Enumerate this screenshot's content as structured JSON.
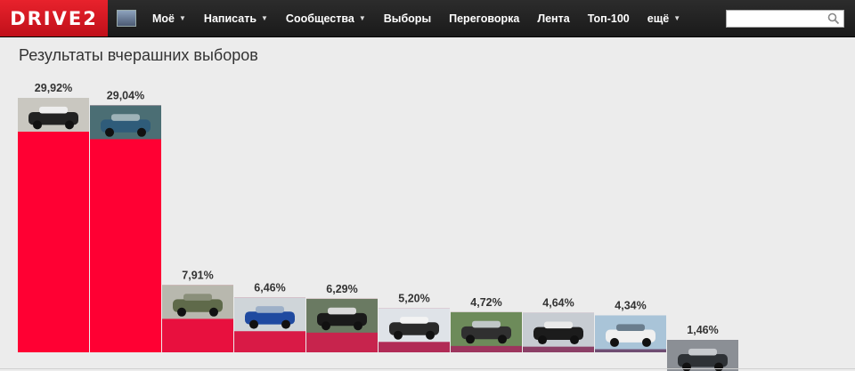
{
  "header": {
    "logo": "DRIVE2",
    "nav": [
      {
        "label": "Моё",
        "dropdown": true
      },
      {
        "label": "Написать",
        "dropdown": true
      },
      {
        "label": "Сообщества",
        "dropdown": true
      },
      {
        "label": "Выборы",
        "dropdown": false
      },
      {
        "label": "Переговорка",
        "dropdown": false
      },
      {
        "label": "Лента",
        "dropdown": false
      },
      {
        "label": "Топ-100",
        "dropdown": false
      },
      {
        "label": "ещё",
        "dropdown": true
      }
    ],
    "search": {
      "placeholder": "",
      "value": ""
    }
  },
  "main": {
    "title": "Результаты вчерашних выборов"
  },
  "chart_data": {
    "type": "bar",
    "title": "Результаты вчерашних выборов",
    "values": [
      29.92,
      29.04,
      7.91,
      6.46,
      6.29,
      5.2,
      4.72,
      4.64,
      4.34,
      1.46
    ],
    "labels": [
      "29,92%",
      "29,04%",
      "7,91%",
      "6,46%",
      "6,29%",
      "5,20%",
      "4,72%",
      "4,64%",
      "4,34%",
      "1,46%"
    ],
    "bar_colors": [
      "#ff0033",
      "#ff0033",
      "#e8103e",
      "#d91a46",
      "#c7244d",
      "#b12b56",
      "#9d355d",
      "#8b3f66",
      "#6f4d72",
      "#5a5a80"
    ],
    "images": [
      "police-monster-truck",
      "classic-blue-sedan",
      "green-military-truck",
      "blue-hatchback",
      "bmw-e34",
      "white-sedan-snow",
      "dark-coupe",
      "black-sedan-snow",
      "white-sedan-city",
      "car-interior"
    ],
    "ylim": [
      0,
      29.92
    ],
    "grid": false
  }
}
